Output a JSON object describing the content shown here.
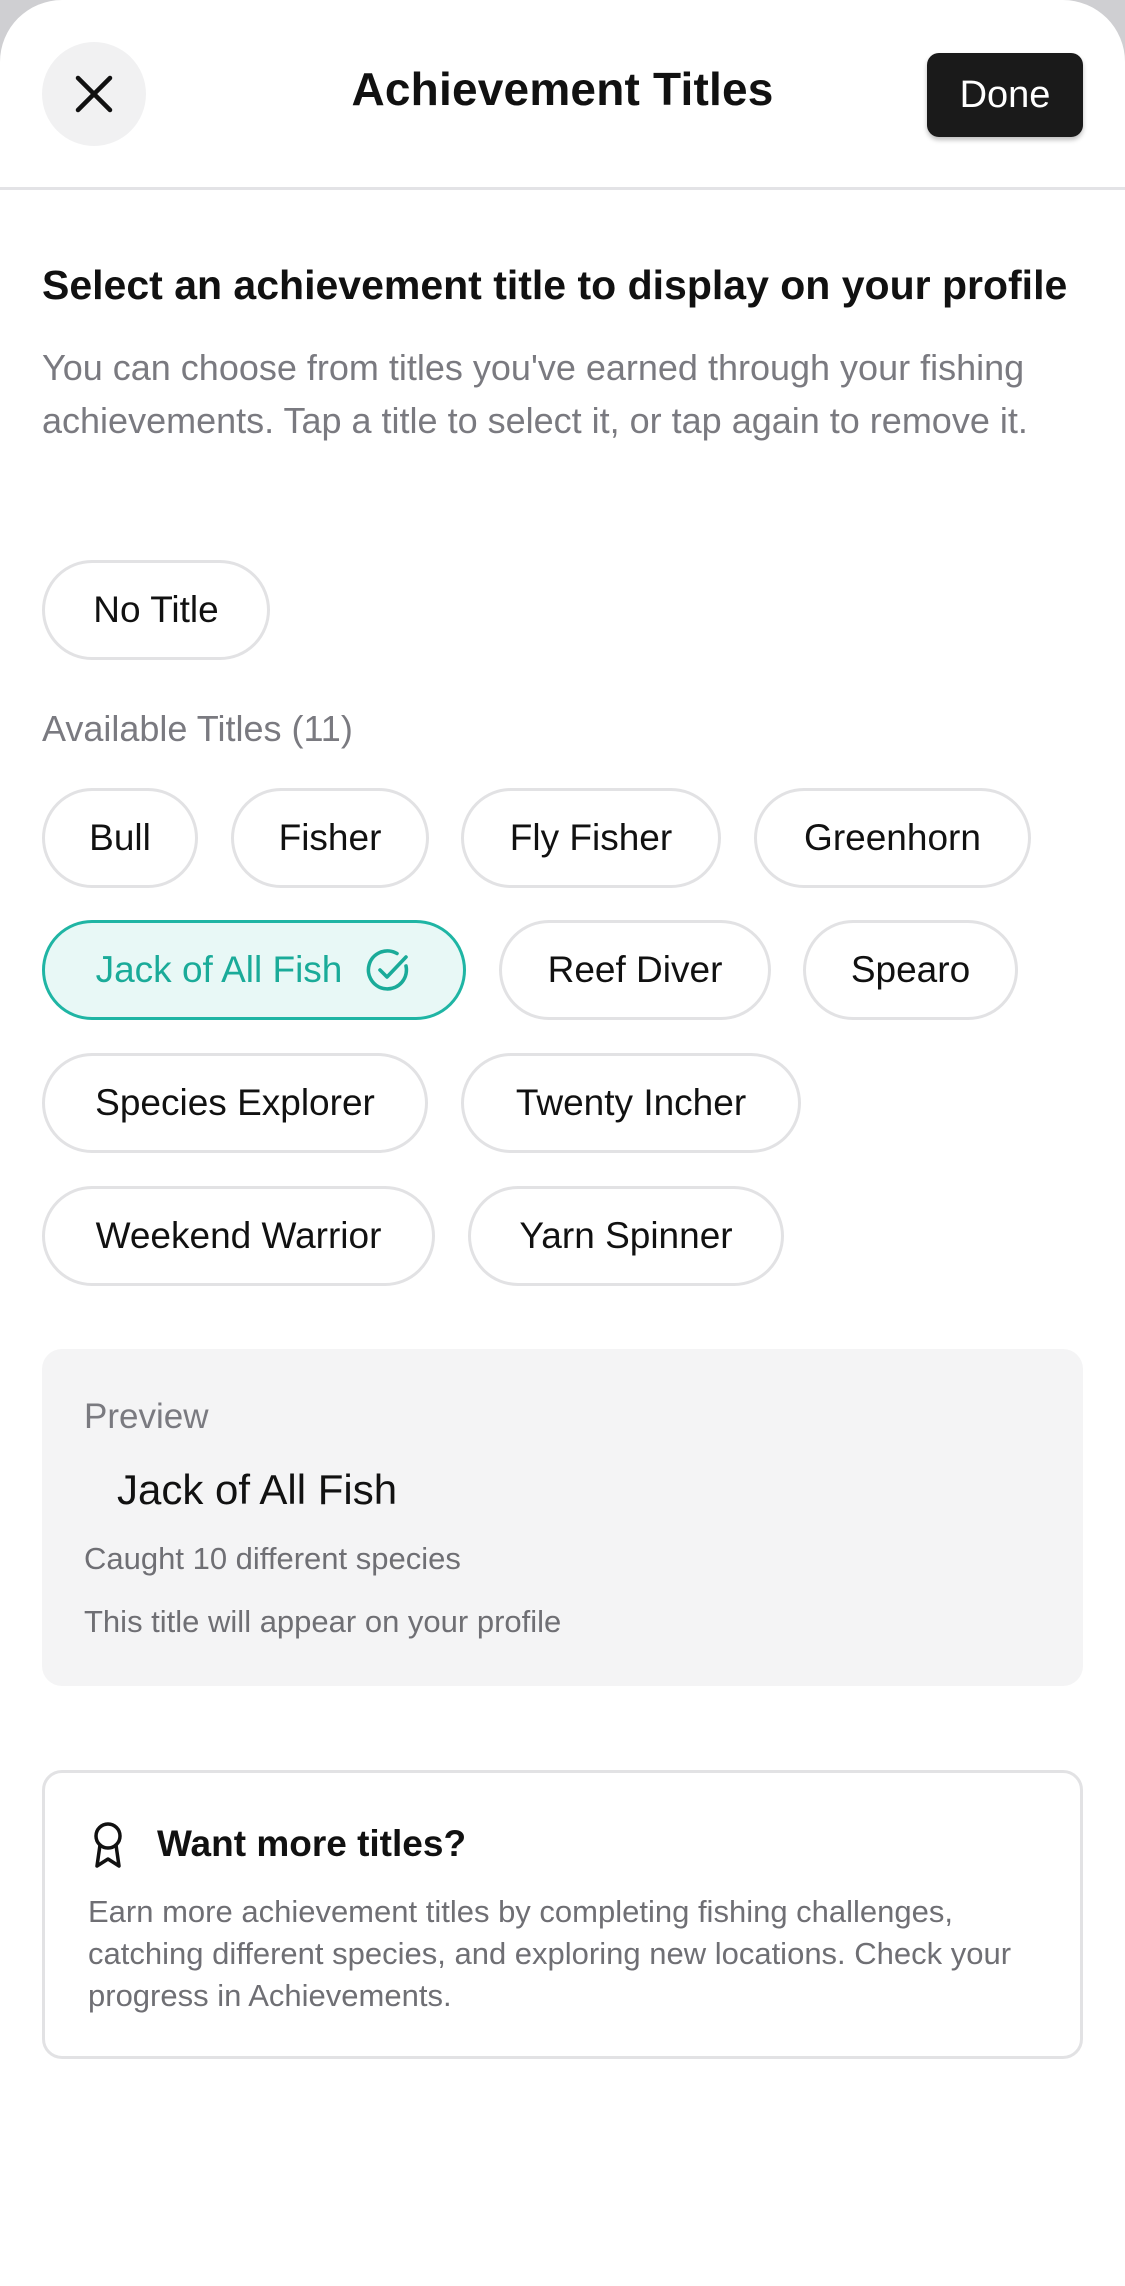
{
  "header": {
    "title": "Achievement Titles",
    "done_label": "Done",
    "close_icon": "close-icon"
  },
  "intro": {
    "title": "Select an achievement title to display on your profile",
    "description": "You can choose from titles you've earned through your fishing achievements. Tap a title to select it, or tap again to remove it."
  },
  "no_title_label": "No Title",
  "available": {
    "label": "Available Titles (11)",
    "titles": [
      {
        "label": "Bull",
        "selected": false
      },
      {
        "label": "Fisher",
        "selected": false
      },
      {
        "label": "Fly Fisher",
        "selected": false
      },
      {
        "label": "Greenhorn",
        "selected": false
      },
      {
        "label": "Jack of All Fish",
        "selected": true
      },
      {
        "label": "Reef Diver",
        "selected": false
      },
      {
        "label": "Spearo",
        "selected": false
      },
      {
        "label": "Species Explorer",
        "selected": false
      },
      {
        "label": "Twenty Incher",
        "selected": false
      },
      {
        "label": "Weekend Warrior",
        "selected": false
      },
      {
        "label": "Yarn Spinner",
        "selected": false
      }
    ]
  },
  "preview": {
    "label": "Preview",
    "title": "Jack of All Fish",
    "description": "Caught 10 different species",
    "note": "This title will appear on your profile"
  },
  "info": {
    "icon": "award-icon",
    "title": "Want more titles?",
    "description": "Earn more achievement titles by completing fishing challenges, catching different species, and exploring new locations. Check your progress in Achievements."
  },
  "colors": {
    "accent": "#1fb5a4",
    "accent_bg": "#e8f8f6",
    "done_bg": "#1a1a1a",
    "muted_text": "#7a7a80"
  }
}
